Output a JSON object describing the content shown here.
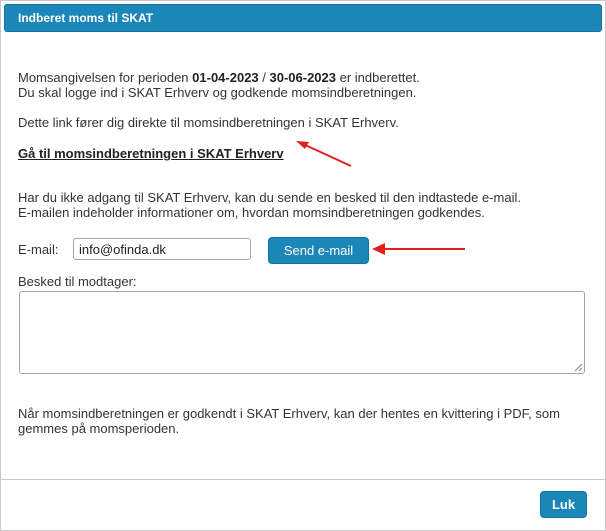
{
  "dialog": {
    "title": "Indberet moms til SKAT"
  },
  "intro": {
    "line1_prefix": "Momsangivelsen for perioden ",
    "period_start": "01-04-2023",
    "period_sep": " / ",
    "period_end": "30-06-2023",
    "line1_suffix": " er indberettet.",
    "line2": "Du skal logge ind i SKAT Erhverv og godkende momsindberetningen.",
    "line3": "Dette link fører dig direkte til momsindberetningen i SKAT Erhverv."
  },
  "link": {
    "label": "Gå til momsindberetningen i SKAT Erhverv"
  },
  "no_access": {
    "line1": "Har du ikke adgang til SKAT Erhverv, kan du sende en besked til den indtastede e-mail.",
    "line2": "E-mailen indeholder informationer om, hvordan momsindberetningen godkendes."
  },
  "email": {
    "label": "E-mail:",
    "value": "info@ofinda.dk",
    "send_label": "Send e-mail"
  },
  "message": {
    "label": "Besked til modtager:",
    "value": ""
  },
  "footer_note": {
    "line1": "Når momsindberetningen er godkendt i SKAT Erhverv, kan der hentes en kvittering i PDF, som",
    "line2": "gemmes på momsperioden."
  },
  "footer": {
    "close_label": "Luk"
  },
  "colors": {
    "accent": "#1a87b8",
    "arrow": "#e0201c"
  }
}
